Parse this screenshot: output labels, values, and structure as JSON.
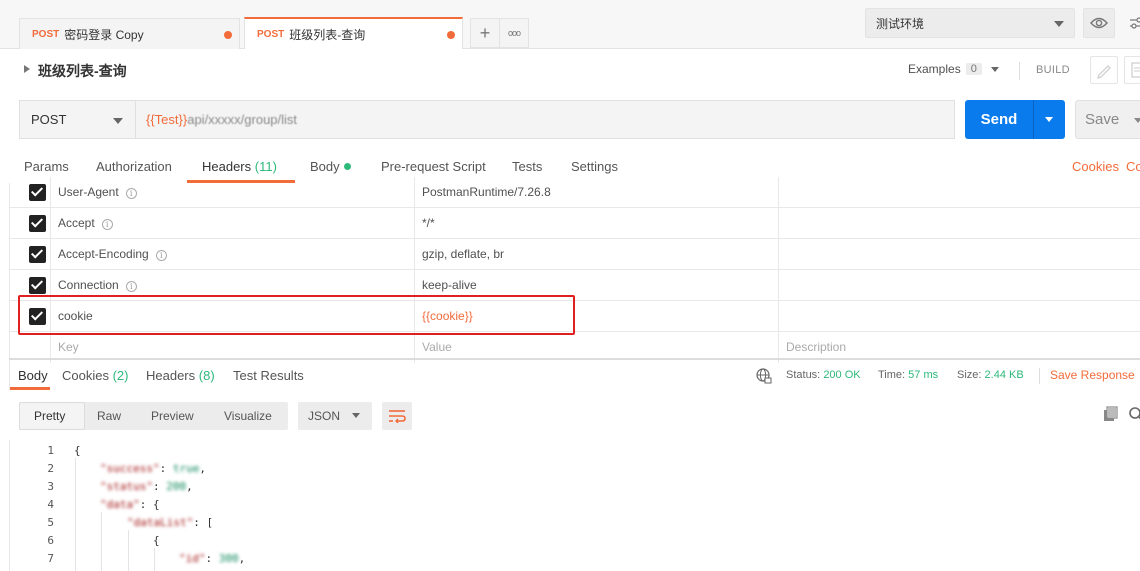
{
  "tabs": [
    {
      "method": "POST",
      "name": "密码登录 Copy"
    },
    {
      "method": "POST",
      "name": "班级列表-查询"
    }
  ],
  "new_tab_symbol": "+",
  "more_symbol": "ooo",
  "environment": {
    "selected": "测试环境"
  },
  "request": {
    "title": "班级列表-查询",
    "examples_label": "Examples",
    "examples_count": "0",
    "build_label": "BUILD",
    "method": "POST",
    "url_var": "{{Test}}",
    "url_rest": "api/xxxxx/group/list"
  },
  "buttons": {
    "send": "Send",
    "save": "Save"
  },
  "request_tabs": {
    "params": "Params",
    "authorization": "Authorization",
    "headers": "Headers",
    "headers_count": "(11)",
    "body": "Body",
    "pre_request": "Pre-request Script",
    "tests": "Tests",
    "settings": "Settings",
    "cookies": "Cookies",
    "code": "Co"
  },
  "headers": [
    {
      "key": "User-Agent",
      "value": "PostmanRuntime/7.26.8"
    },
    {
      "key": "Accept",
      "value": "*/*"
    },
    {
      "key": "Accept-Encoding",
      "value": "gzip, deflate, br"
    },
    {
      "key": "Connection",
      "value": "keep-alive"
    },
    {
      "key": "cookie",
      "value": "{{cookie}}"
    }
  ],
  "headers_placeholder": {
    "key": "Key",
    "value": "Value",
    "description": "Description"
  },
  "response_tabs": {
    "body": "Body",
    "cookies": "Cookies",
    "cookies_count": "(2)",
    "headers": "Headers",
    "headers_count": "(8)",
    "test_results": "Test Results"
  },
  "status": {
    "status_label": "Status:",
    "status_value": "200 OK",
    "time_label": "Time:",
    "time_value": "57 ms",
    "size_label": "Size:",
    "size_value": "2.44 KB",
    "save_response": "Save Response"
  },
  "response_views": [
    "Pretty",
    "Raw",
    "Preview",
    "Visualize"
  ],
  "format": "JSON",
  "code_lines": [
    "1",
    "2",
    "3",
    "4",
    "5",
    "6",
    "7"
  ],
  "code": {
    "l1": "{",
    "l2_key": "\"success\"",
    "l2_val": "true",
    "l3_key": "\"status\"",
    "l3_val": "200",
    "l4_key": "\"data\"",
    "l4_punct": ": {",
    "l5_key": "\"dataList\"",
    "l5_punct": ": [",
    "l6": "{",
    "l7_key": "\"id\"",
    "l7_val": "300"
  },
  "colors": {
    "accent": "#f26b3a",
    "send": "#097bed",
    "green": "#2eb87a",
    "highlight": "#e02020"
  }
}
